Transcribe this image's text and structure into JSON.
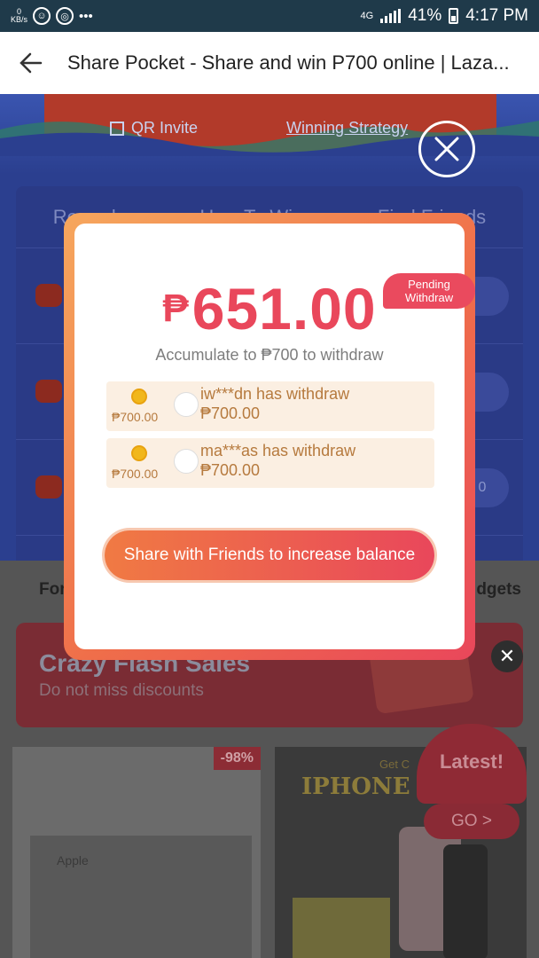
{
  "status_bar": {
    "speed_value": "0",
    "speed_unit": "KB/s",
    "network": "4G",
    "battery": "41%",
    "time": "4:17 PM"
  },
  "app_bar": {
    "title": "Share Pocket - Share and win P700 online | Laza..."
  },
  "background": {
    "qr_invite": "QR Invite",
    "winning_strategy": "Winning Strategy",
    "tabs": [
      "Records",
      "How To Win",
      "Find Friends"
    ],
    "for_label": "For",
    "gadgets_label": "dgets",
    "flash_title": "Crazy Flash Sales",
    "flash_sub": "Do not miss discounts",
    "discount": "-98%",
    "apple_label": "Apple",
    "iphone_label": "IPHONE 12 and",
    "get_label": "Get C",
    "latest": "Latest!",
    "go": "GO >"
  },
  "modal": {
    "currency": "₱",
    "amount": "651.00",
    "badge_line1": "Pending",
    "badge_line2": "Withdraw",
    "accumulate_text": "Accumulate to ₱700 to withdraw",
    "feed": [
      {
        "coin_amount": "₱700.00",
        "message": "iw***dn has withdraw",
        "amount": "₱700.00"
      },
      {
        "coin_amount": "₱700.00",
        "message": "ma***as has withdraw",
        "amount": "₱700.00"
      }
    ],
    "share_button": "Share with Friends to increase balance"
  }
}
